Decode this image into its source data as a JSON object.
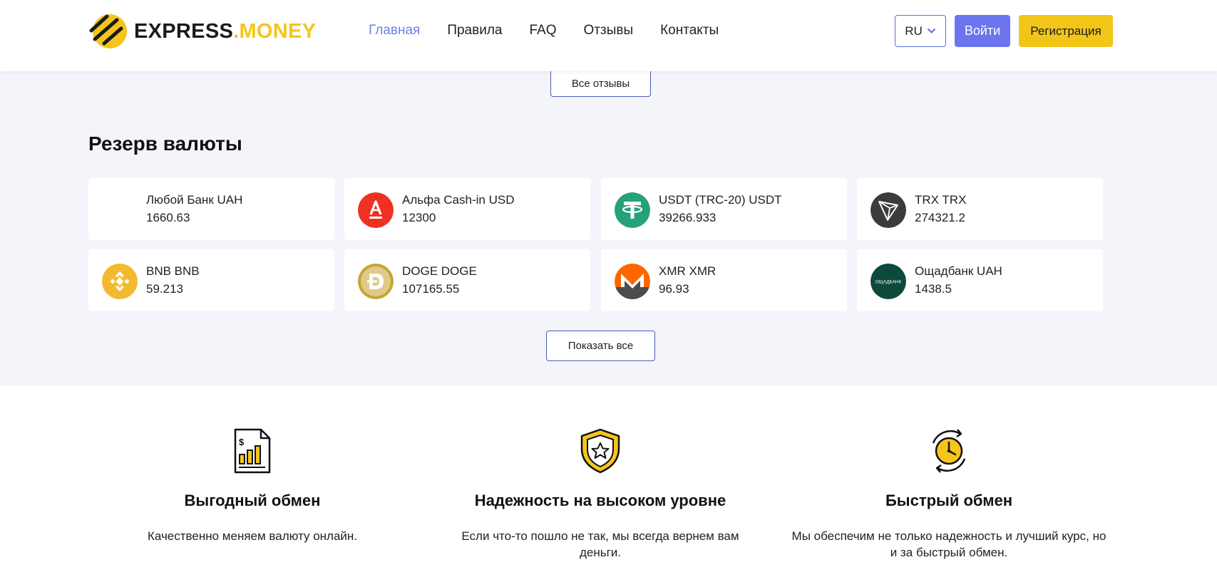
{
  "brand": {
    "name_part1": "EXPRESS",
    "name_part2": ".MONEY",
    "accent_yellow": "#f5c51c"
  },
  "nav": [
    {
      "label": "Главная",
      "active": true
    },
    {
      "label": "Правила",
      "active": false
    },
    {
      "label": "FAQ",
      "active": false
    },
    {
      "label": "Отзывы",
      "active": false
    },
    {
      "label": "Контакты",
      "active": false
    }
  ],
  "header": {
    "language": "RU",
    "language_icon": "chevron-down-icon",
    "login_label": "Войти",
    "register_label": "Регистрация",
    "login_color": "#6b75ee",
    "register_color": "#f2c618"
  },
  "reviews": {
    "all_reviews_label": "Все отзывы"
  },
  "reserve": {
    "title": "Резерв валюты",
    "show_all_label": "Показать все",
    "items": [
      {
        "name": "Любой Банк UAH",
        "amount": "1660.63",
        "icon": "blank"
      },
      {
        "name": "Альфа Cash-in USD",
        "amount": "12300",
        "icon": "alfa-bank-icon"
      },
      {
        "name": "USDT (TRC-20) USDT",
        "amount": "39266.933",
        "icon": "tether-icon"
      },
      {
        "name": "TRX TRX",
        "amount": "274321.2",
        "icon": "tron-icon"
      },
      {
        "name": "BNB BNB",
        "amount": "59.213",
        "icon": "binance-icon"
      },
      {
        "name": "DOGE DOGE",
        "amount": "107165.55",
        "icon": "dogecoin-icon"
      },
      {
        "name": "XMR XMR",
        "amount": "96.93",
        "icon": "monero-icon"
      },
      {
        "name": "Ощадбанк UAH",
        "amount": "1438.5",
        "icon": "oschadbank-icon",
        "icon_text": "ОЩАДБАНК"
      }
    ]
  },
  "features": [
    {
      "title": "Выгодный обмен",
      "description": "Качественно меняем валюту онлайн.",
      "icon": "profit-report-icon"
    },
    {
      "title": "Надежность на высоком уровне",
      "description": "Если что-то пошло не так, мы всегда вернем вам деньги.",
      "icon": "shield-star-icon"
    },
    {
      "title": "Быстрый обмен",
      "description": "Мы обеспечим не только надежность и лучший курс, но и за быстрый обмен.",
      "icon": "fast-clock-icon"
    }
  ]
}
